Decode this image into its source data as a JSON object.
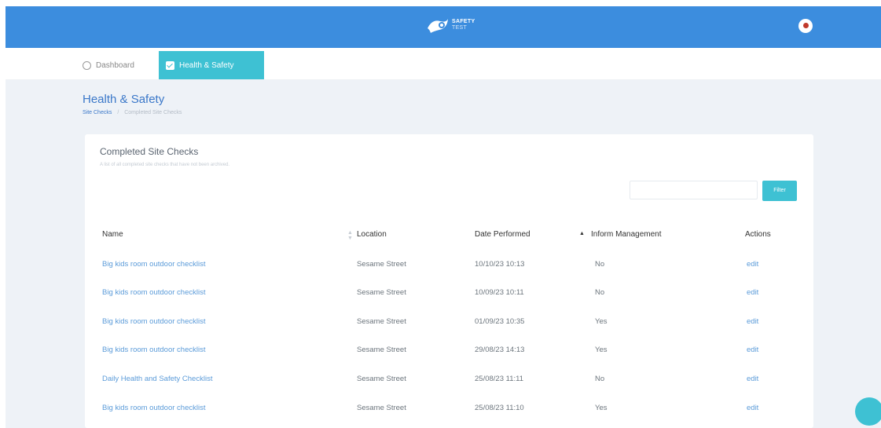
{
  "header": {
    "logo_text_line1": "SAFETY",
    "logo_text_line2": "TEST"
  },
  "tabs": [
    {
      "label": "Dashboard",
      "icon": "dashboard-icon"
    },
    {
      "label": "Health & Safety",
      "icon": "checkbox-icon",
      "active": true
    }
  ],
  "page": {
    "title": "Health & Safety",
    "breadcrumb": {
      "link": "Site Checks",
      "separator": "/",
      "current": "Completed Site Checks"
    }
  },
  "card": {
    "title": "Completed Site Checks",
    "subtitle": "A list of all completed site checks that have not been archived.",
    "filter": {
      "placeholder": "",
      "value": "",
      "button_label": "Filter"
    }
  },
  "table": {
    "columns": [
      "Name",
      "Location",
      "Date Performed",
      "Inform Management",
      "Actions"
    ],
    "rows": [
      {
        "name": "Big kids room outdoor checklist",
        "location": "Sesame Street",
        "date": "10/10/23 10:13",
        "inform": "No",
        "action": "edit"
      },
      {
        "name": "Big kids room outdoor checklist",
        "location": "Sesame Street",
        "date": "10/09/23 10:11",
        "inform": "No",
        "action": "edit"
      },
      {
        "name": "Big kids room outdoor checklist",
        "location": "Sesame Street",
        "date": "01/09/23 10:35",
        "inform": "Yes",
        "action": "edit"
      },
      {
        "name": "Big kids room outdoor checklist",
        "location": "Sesame Street",
        "date": "29/08/23 14:13",
        "inform": "Yes",
        "action": "edit"
      },
      {
        "name": "Daily Health and Safety Checklist",
        "location": "Sesame Street",
        "date": "25/08/23 11:11",
        "inform": "No",
        "action": "edit"
      },
      {
        "name": "Big kids room outdoor checklist",
        "location": "Sesame Street",
        "date": "25/08/23 11:10",
        "inform": "Yes",
        "action": "edit"
      }
    ]
  },
  "colors": {
    "header_bg": "#3c8dde",
    "accent": "#3ec1d3",
    "link": "#5b9bd9",
    "page_bg": "#eef2f7"
  },
  "icons": [
    "safety-logo-icon",
    "user-avatar-icon",
    "dashboard-icon",
    "checkbox-icon",
    "sort-icon",
    "help-icon"
  ]
}
